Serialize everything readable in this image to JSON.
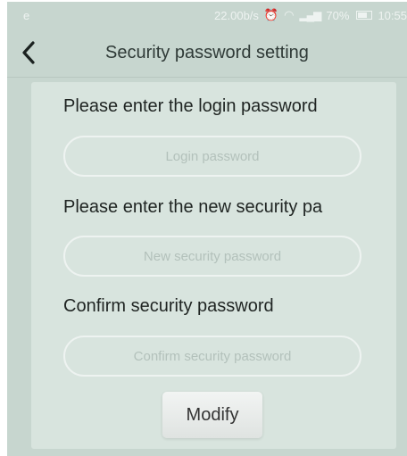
{
  "status_bar": {
    "left_icon": "e",
    "net_speed": "22.00b/s",
    "battery_text": "70%",
    "time": "10:55"
  },
  "header": {
    "title": "Security password setting",
    "back_icon": "chevron-left"
  },
  "form": {
    "login_label": "Please enter the login password",
    "login_placeholder": "Login password",
    "new_label": "Please enter the new security pa",
    "new_placeholder": "New security password",
    "confirm_label": "Confirm security password",
    "confirm_placeholder": "Confirm security password",
    "submit_label": "Modify"
  },
  "colors": {
    "background": "#c7d6cf",
    "card": "#d8e4de",
    "input_border": "#eef3f1"
  }
}
